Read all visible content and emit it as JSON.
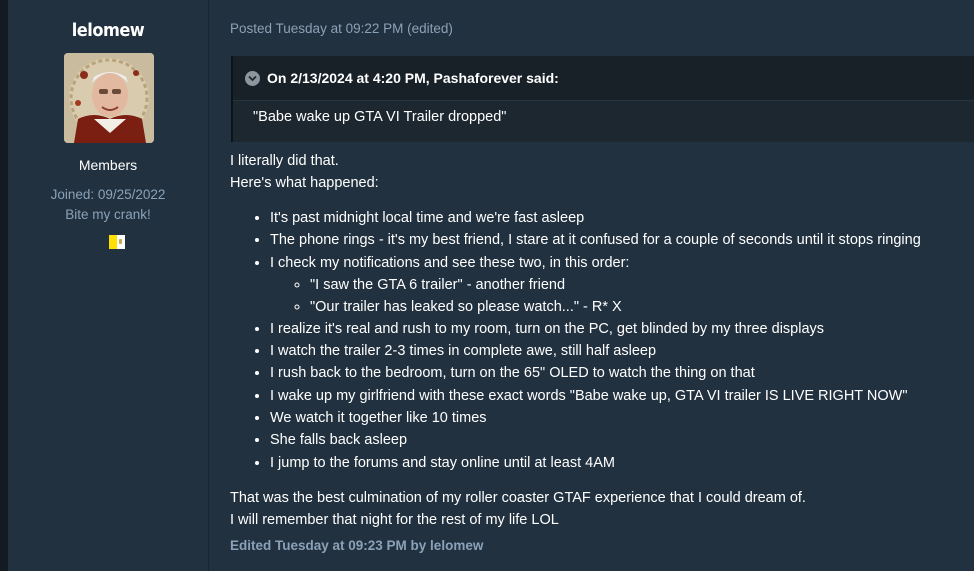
{
  "author": {
    "username": "lelomew",
    "group": "Members",
    "joined": "Joined: 09/25/2022",
    "tagline": "Bite my crank!",
    "flag_colors": [
      "#ffe000",
      "#ffffff"
    ]
  },
  "post": {
    "meta": "Posted Tuesday at 09:22 PM (edited)",
    "quote": {
      "header": "On 2/13/2024 at 4:20 PM, Pashaforever said:",
      "text": "\"Babe wake up GTA VI Trailer dropped\"",
      "toggle_icon": "chevron-down-icon"
    },
    "intro": [
      "I literally did that.",
      "Here's what happened:"
    ],
    "items": [
      "It's past midnight local time and we're fast asleep",
      "The phone rings - it's my best friend, I stare at it confused for a couple of seconds until it stops ringing",
      "I check my notifications and see these two, in this order:",
      "I realize it's real and rush to my room, turn on the PC, get blinded by my three displays",
      "I watch the trailer 2-3 times in complete awe, still half asleep",
      "I rush back to the bedroom, turn on the 65\" OLED to watch the thing on that",
      "I wake up my girlfriend with these exact words \"Babe wake up, GTA VI trailer IS LIVE RIGHT NOW\"",
      "We watch it together like 10 times",
      "She falls back asleep",
      "I jump to the forums and stay online until at least 4AM"
    ],
    "subitems": [
      "\"I saw the GTA 6 trailer\" - another friend",
      "\"Our trailer has leaked so please watch...\" - R* X"
    ],
    "outro": [
      "That was the best culmination of my roller coaster GTAF experience that I could dream of.",
      "I will remember that night for the rest of my life LOL"
    ],
    "edited": "Edited Tuesday at 09:23 PM by lelomew"
  }
}
